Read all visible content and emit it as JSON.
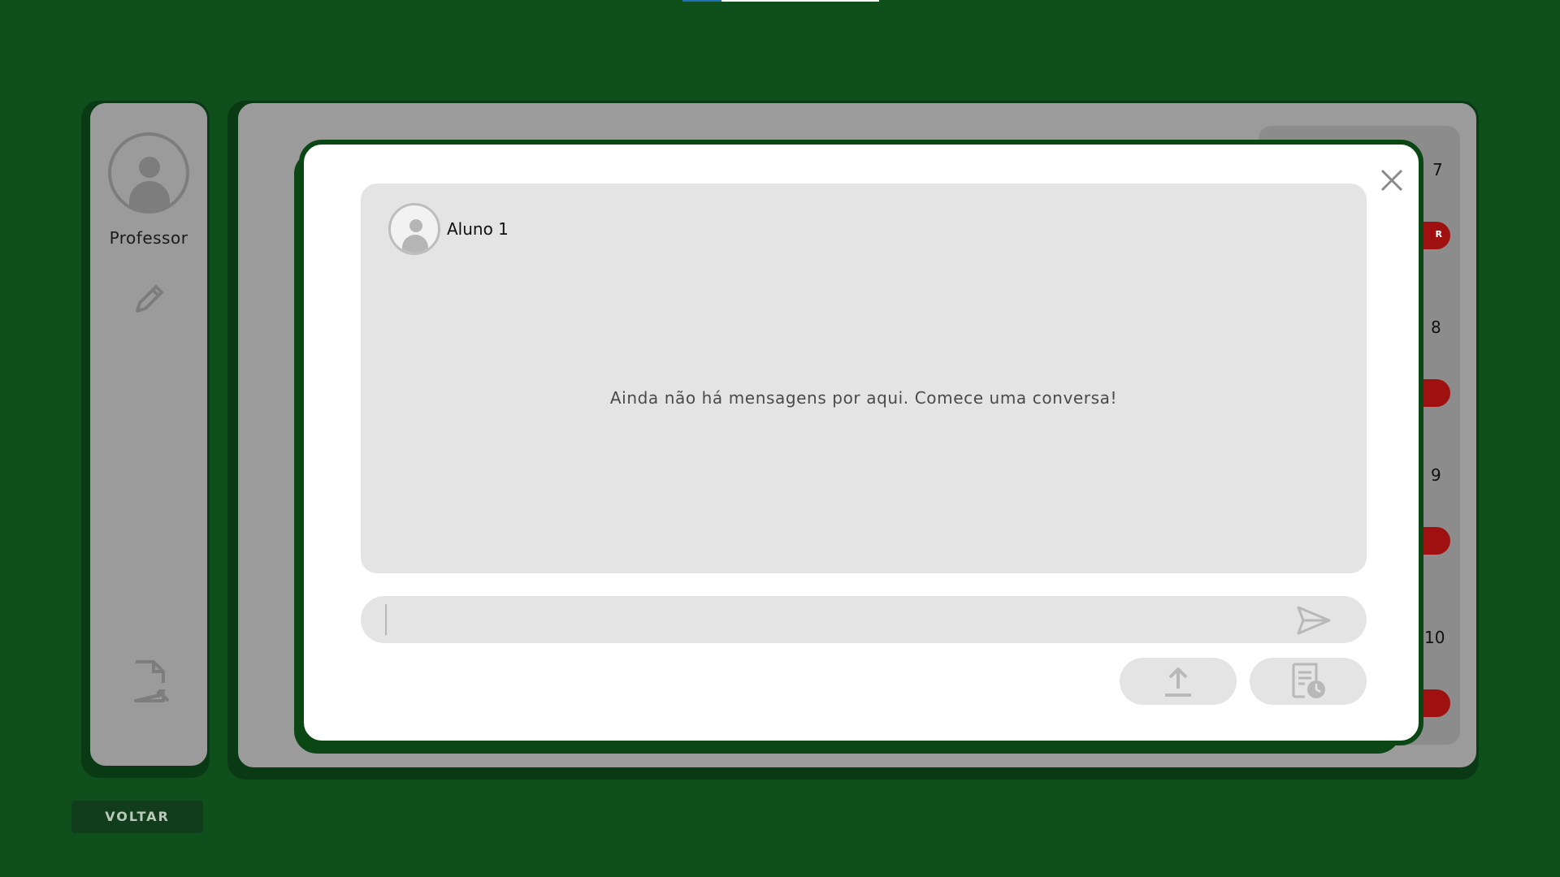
{
  "sidebar": {
    "user_name": "Professor",
    "icons": [
      "avatar-icon",
      "pencil-icon",
      "file-export-icon"
    ]
  },
  "background_panel": {
    "numbers": [
      "7",
      "8",
      "9",
      "10"
    ],
    "badge_text": "R"
  },
  "modal": {
    "chat_user": "Aluno 1",
    "empty_message": "Ainda não há mensagens por aqui. Comece uma conversa!",
    "input_value": "",
    "icons": [
      "close-icon",
      "send-icon",
      "upload-icon",
      "history-icon"
    ]
  },
  "footer": {
    "back_label": "VOLTAR"
  },
  "colors": {
    "background": "#0f4f1c",
    "panel": "#9b9b9b",
    "modal": "#ffffff",
    "chat_area": "#e3e4e3",
    "badge": "#9f1111"
  }
}
